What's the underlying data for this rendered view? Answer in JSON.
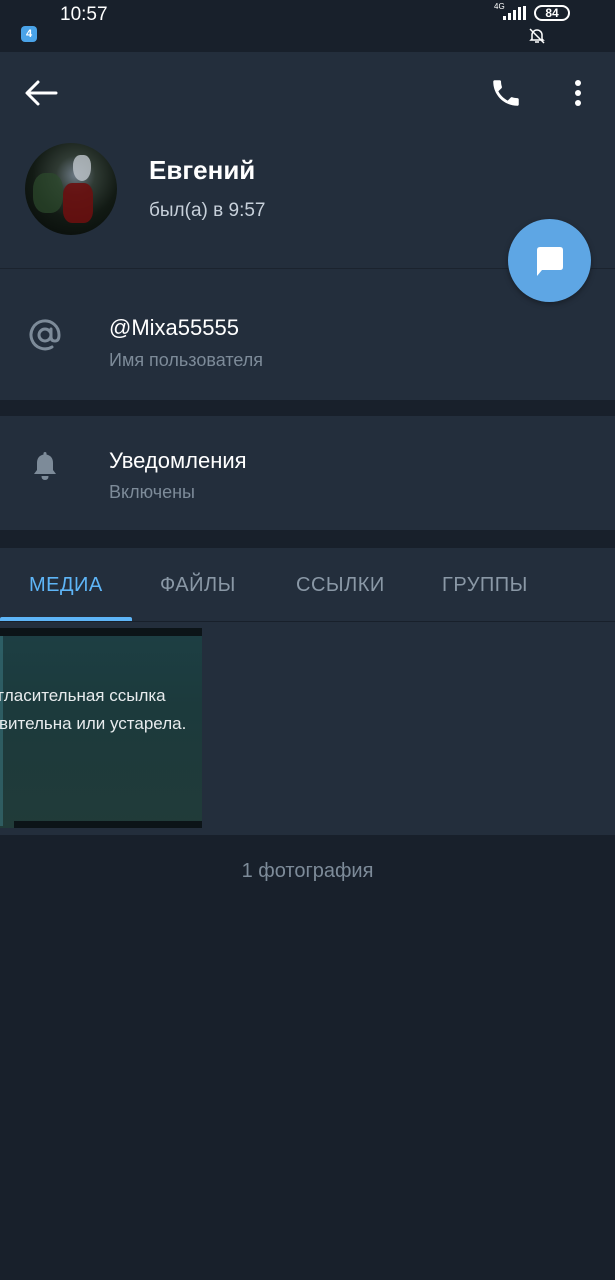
{
  "status_bar": {
    "time": "10:57",
    "network": "4G",
    "battery": "84",
    "app_icon_letter": "4"
  },
  "header": {
    "back_icon": "arrow-left-icon",
    "call_icon": "phone-icon",
    "menu_icon": "more-vertical-icon"
  },
  "profile": {
    "name": "Евгений",
    "status": "был(а) в 9:57"
  },
  "fab_icon": "chat-bubble-icon",
  "username_row": {
    "icon": "at-sign-icon",
    "value": "@Mixa55555",
    "label": "Имя пользователя"
  },
  "notifications_row": {
    "icon": "bell-icon",
    "value": "Уведомления",
    "label": "Включены"
  },
  "tabs": [
    {
      "label": "МЕДИА",
      "active": true
    },
    {
      "label": "ФАЙЛЫ",
      "active": false
    },
    {
      "label": "ССЫЛКИ",
      "active": false
    },
    {
      "label": "ГРУППЫ",
      "active": false
    }
  ],
  "media": {
    "thumb_line_1": "гласительная ссылка",
    "thumb_line_2": "вительна или устарела."
  },
  "photo_count": "1 фотография",
  "colors": {
    "background": "#18202b",
    "panel": "#232e3c",
    "accent": "#5eb5f7",
    "fab": "#5ea6e4",
    "secondary_text": "#7d8b99"
  }
}
